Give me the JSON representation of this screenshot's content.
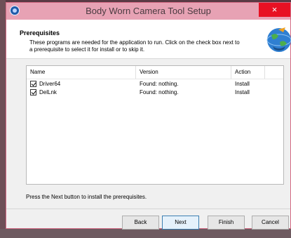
{
  "window": {
    "title": "Body Worn Camera Tool Setup",
    "close_glyph": "×"
  },
  "header": {
    "heading": "Prerequisites",
    "description": "These programs are needed for the application to run. Click on the check box next to a prerequisite to select it for install or to skip it."
  },
  "list": {
    "columns": [
      "Name",
      "Version",
      "Action"
    ],
    "rows": [
      {
        "checked": true,
        "name": "Driver64",
        "version": "Found: nothing.",
        "action": "Install"
      },
      {
        "checked": true,
        "name": "DelLnk",
        "version": "Found: nothing.",
        "action": "Install"
      }
    ]
  },
  "footer": {
    "hint": "Press the Next button to install the prerequisites."
  },
  "buttons": {
    "back": "Back",
    "next": "Next",
    "finish": "Finish",
    "cancel": "Cancel"
  },
  "colors": {
    "titlebar": "#e7a2b4",
    "close_button": "#e81123",
    "default_button_border": "#3c7fb1"
  },
  "icons": {
    "app": "app-icon",
    "setup": "setup-globe-icon",
    "checkbox": "checkbox-checked-icon"
  }
}
